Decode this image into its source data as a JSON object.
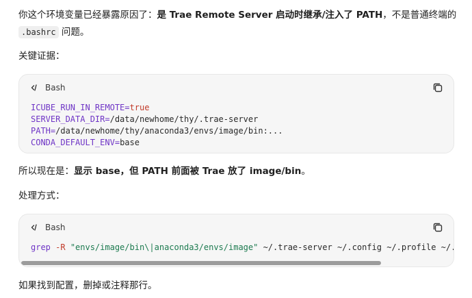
{
  "intro": {
    "line1_plain": "你这个环境变量已经暴露原因了：",
    "line1_bold": "是 Trae Remote Server 启动时继承/注入了 PATH",
    "line1_tail": "，不是普通终端的",
    "line2_code": ".bashrc",
    "line2_tail": " 问题。"
  },
  "evidence_heading": "关键证据：",
  "code_block_1": {
    "lang": "Bash",
    "lines": [
      {
        "var": "ICUBE_RUN_IN_REMOTE",
        "eq": "=",
        "val": "true"
      },
      {
        "var": "SERVER_DATA_DIR",
        "eq": "=",
        "val": "/data/newhome/thy/.trae-server"
      },
      {
        "var": "PATH",
        "eq": "=",
        "val": "/data/newhome/thy/anaconda3/envs/image/bin:..."
      },
      {
        "var": "CONDA_DEFAULT_ENV",
        "eq": "=",
        "val": "base"
      }
    ]
  },
  "now": {
    "plain": "所以现在是：",
    "bold": "显示 base，但 PATH 前面被 Trae 放了 image/bin",
    "tail": "。"
  },
  "handling_heading": "处理方式：",
  "code_block_2": {
    "lang": "Bash",
    "cmd": "grep",
    "flag": " -R ",
    "str": "\"envs/image/bin\\|anaconda3/envs/image\"",
    "rest": " ~/.trae-server ~/.config ~/.profile ~/.bas"
  },
  "footer": "如果找到配置，删掉或注释那行。",
  "colors": {
    "variable": "#6f35c6",
    "string": "#1c7a4f",
    "keyword": "#c13b2a",
    "code_bg": "#f6f6f6"
  }
}
